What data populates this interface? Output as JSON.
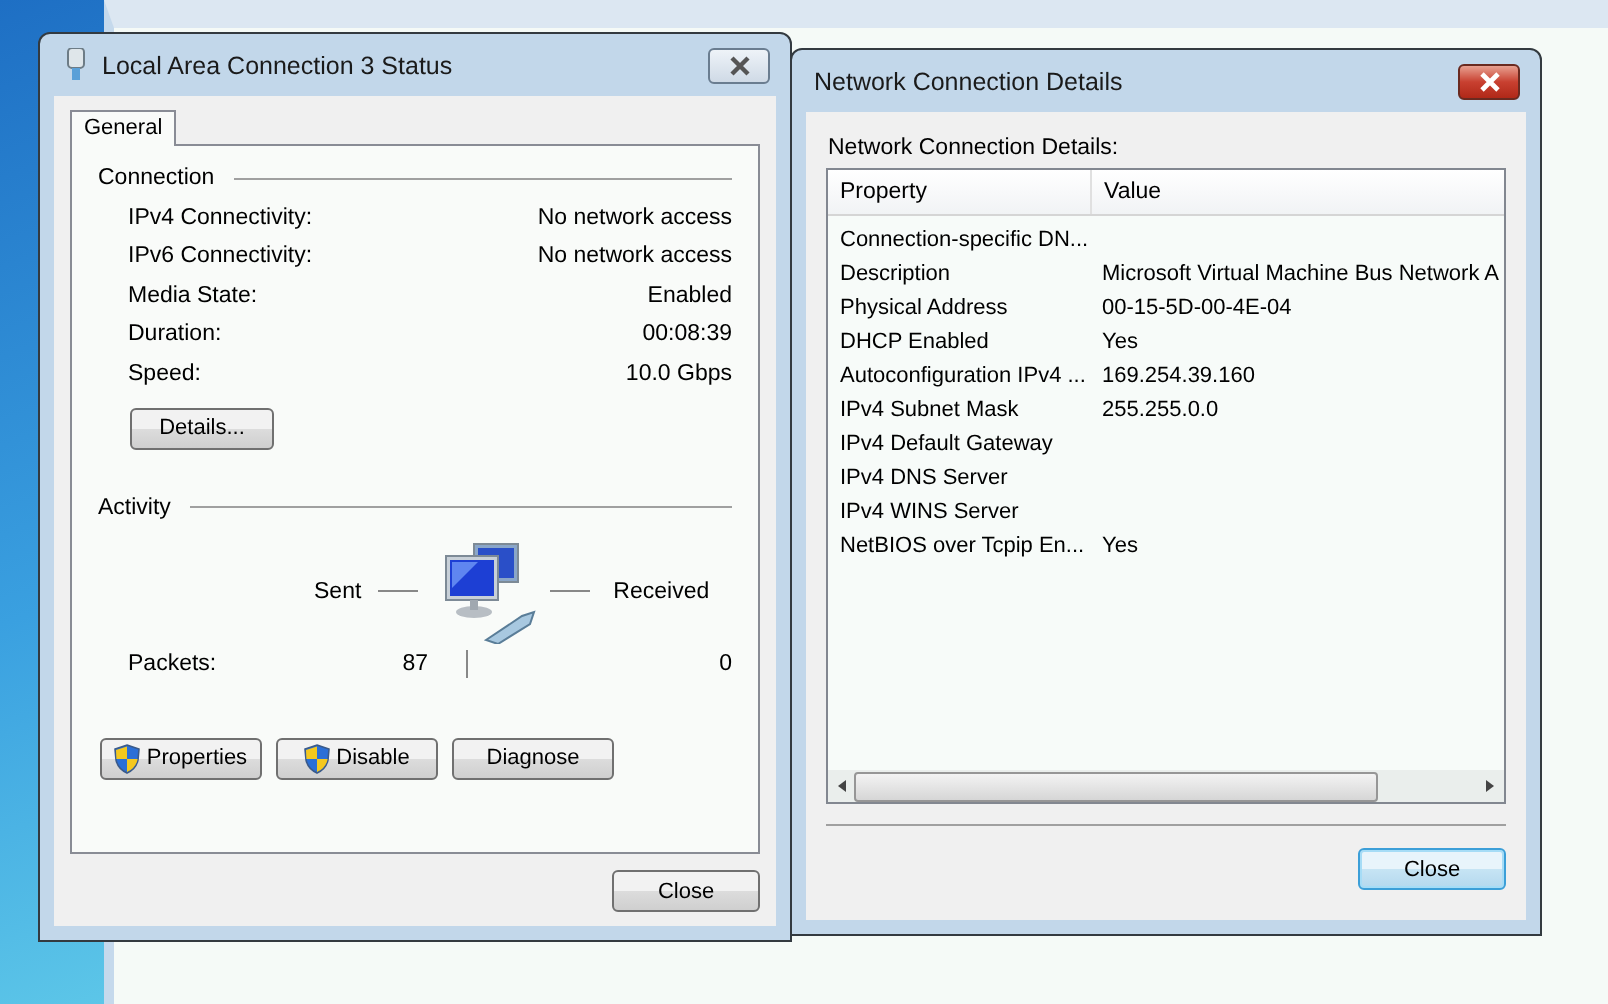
{
  "status_dialog": {
    "title": "Local Area Connection 3 Status",
    "tabs": [
      {
        "label": "General",
        "selected": true
      }
    ],
    "connection": {
      "heading": "Connection",
      "rows": [
        {
          "label": "IPv4 Connectivity:",
          "value": "No network access"
        },
        {
          "label": "IPv6 Connectivity:",
          "value": "No network access"
        },
        {
          "label": "Media State:",
          "value": "Enabled"
        },
        {
          "label": "Duration:",
          "value": "00:08:39"
        },
        {
          "label": "Speed:",
          "value": "10.0 Gbps"
        }
      ]
    },
    "details_button": "Details...",
    "activity": {
      "heading": "Activity",
      "sent_label": "Sent",
      "received_label": "Received",
      "packets_label": "Packets:",
      "sent": "87",
      "received": "0"
    },
    "buttons": [
      {
        "label": "Properties",
        "shield": true
      },
      {
        "label": "Disable",
        "shield": true
      },
      {
        "label": "Diagnose",
        "shield": false
      }
    ],
    "close_button": "Close"
  },
  "details_dialog": {
    "title": "Network Connection Details",
    "list_label": "Network Connection Details:",
    "columns": [
      "Property",
      "Value"
    ],
    "rows": [
      {
        "property": "Connection-specific DN...",
        "value": ""
      },
      {
        "property": "Description",
        "value": "Microsoft Virtual Machine Bus Network A"
      },
      {
        "property": "Physical Address",
        "value": "00-15-5D-00-4E-04"
      },
      {
        "property": "DHCP Enabled",
        "value": "Yes"
      },
      {
        "property": "Autoconfiguration IPv4 ...",
        "value": "169.254.39.160"
      },
      {
        "property": "IPv4 Subnet Mask",
        "value": "255.255.0.0"
      },
      {
        "property": "IPv4 Default Gateway",
        "value": ""
      },
      {
        "property": "IPv4 DNS Server",
        "value": ""
      },
      {
        "property": "IPv4 WINS Server",
        "value": ""
      },
      {
        "property": "NetBIOS over Tcpip En...",
        "value": "Yes"
      }
    ],
    "close_button": "Close"
  }
}
